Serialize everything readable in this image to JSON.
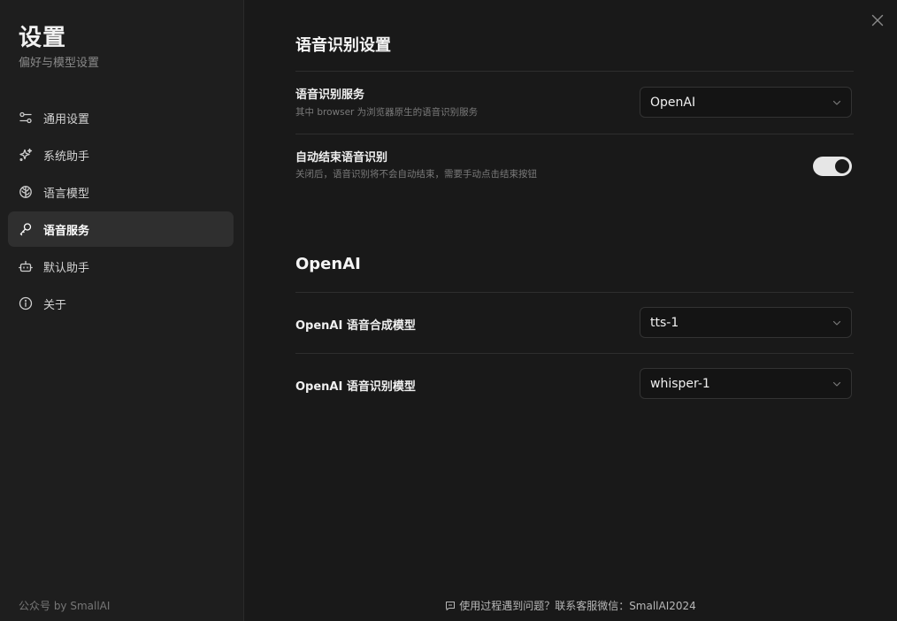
{
  "sidebar": {
    "title": "设置",
    "subtitle": "偏好与模型设置",
    "items": [
      {
        "label": "通用设置",
        "icon": "sliders-icon"
      },
      {
        "label": "系统助手",
        "icon": "sparkles-icon"
      },
      {
        "label": "语言模型",
        "icon": "brain-icon"
      },
      {
        "label": "语音服务",
        "icon": "mic-icon",
        "active": true
      },
      {
        "label": "默认助手",
        "icon": "bot-icon"
      },
      {
        "label": "关于",
        "icon": "info-icon"
      }
    ],
    "footer": "公众号 by SmallAI"
  },
  "main": {
    "speech_section": {
      "title": "语音识别设置",
      "service": {
        "label": "语音识别服务",
        "description": "其中 browser 为浏览器原生的语音识别服务",
        "value": "OpenAI"
      },
      "auto_end": {
        "label": "自动结束语音识别",
        "description": "关闭后，语音识别将不会自动结束，需要手动点击结束按钮",
        "enabled": true
      }
    },
    "openai_section": {
      "title": "OpenAI",
      "tts_model": {
        "label": "OpenAI 语音合成模型",
        "value": "tts-1"
      },
      "stt_model": {
        "label": "OpenAI 语音识别模型",
        "value": "whisper-1"
      }
    },
    "footer_note": "使用过程遇到问题？联系客服微信：SmallAI2024"
  }
}
